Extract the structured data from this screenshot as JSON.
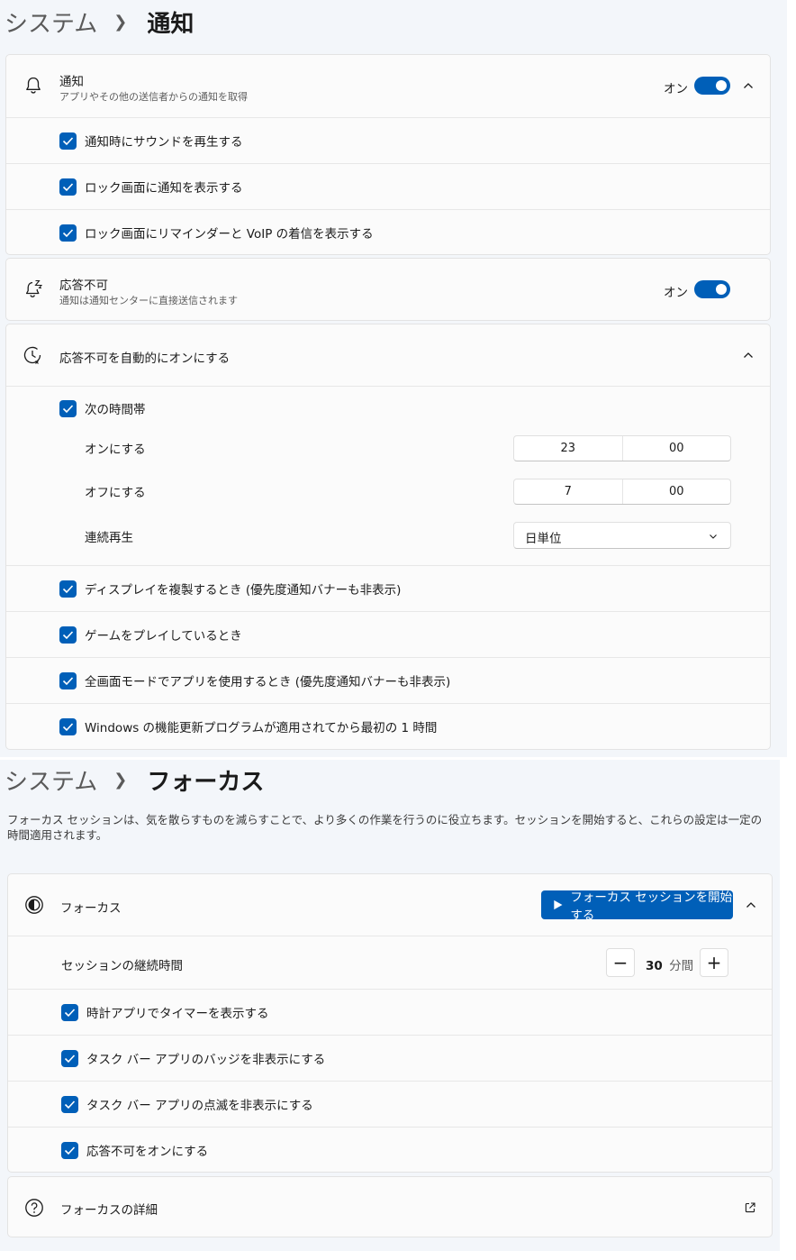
{
  "notifications_page": {
    "breadcrumb": {
      "parent": "システム",
      "current": "通知"
    },
    "notifications": {
      "title": "通知",
      "subtitle": "アプリやその他の送信者からの通知を取得",
      "state": "オン",
      "options": [
        "通知時にサウンドを再生する",
        "ロック画面に通知を表示する",
        "ロック画面にリマインダーと VoIP の着信を表示する"
      ]
    },
    "dnd": {
      "title": "応答不可",
      "subtitle": "通知は通知センターに直接送信されます",
      "state": "オン"
    },
    "auto_dnd": {
      "title": "応答不可を自動的にオンにする",
      "schedule_label": "次の時間帯",
      "on_label": "オンにする",
      "on_hour": "23",
      "on_minute": "00",
      "off_label": "オフにする",
      "off_hour": "7",
      "off_minute": "00",
      "repeat_label": "連続再生",
      "repeat_value": "日単位",
      "options": [
        "ディスプレイを複製するとき (優先度通知バナーも非表示)",
        "ゲームをプレイしているとき",
        "全画面モードでアプリを使用するとき (優先度通知バナーも非表示)",
        "Windows の機能更新プログラムが適用されてから最初の 1 時間"
      ]
    }
  },
  "focus_page": {
    "breadcrumb": {
      "parent": "システム",
      "current": "フォーカス"
    },
    "description": "フォーカス セッションは、気を散らすものを減らすことで、より多くの作業を行うのに役立ちます。セッションを開始すると、これらの設定は一定の時間適用されます。",
    "focus": {
      "title": "フォーカス",
      "start_button": "フォーカス セッションを開始する",
      "duration_label": "セッションの継続時間",
      "duration_value": "30",
      "duration_unit": "分間",
      "options": [
        "時計アプリでタイマーを表示する",
        "タスク バー アプリのバッジを非表示にする",
        "タスク バー アプリの点滅を非表示にする",
        "応答不可をオンにする"
      ]
    },
    "details_link": "フォーカスの詳細"
  },
  "colors": {
    "accent": "#005fb8"
  }
}
